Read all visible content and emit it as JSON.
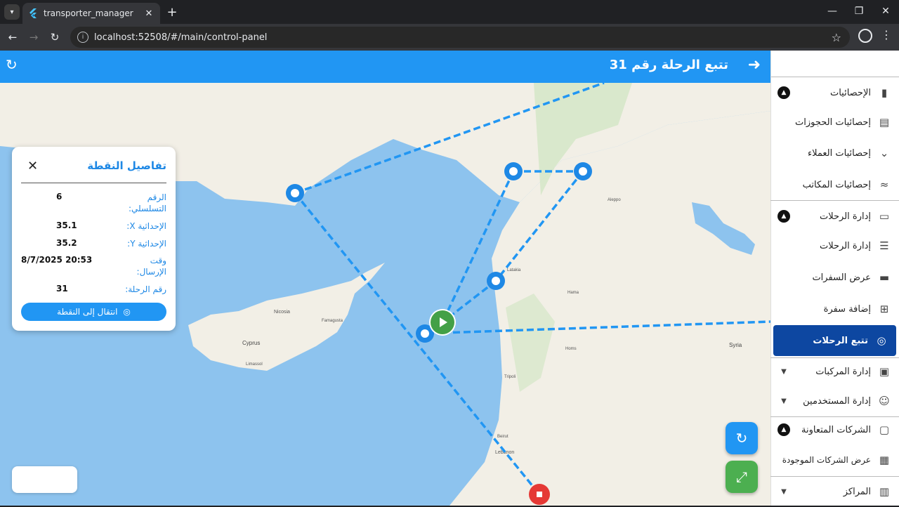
{
  "browser": {
    "tab_title": "transporter_manager",
    "url": "localhost:52508/#/main/control-panel"
  },
  "appbar": {
    "title": "تتبع الرحلة رقم 31"
  },
  "sidebar": {
    "items": [
      {
        "label": "الإحصائيات",
        "icon": "bar-chart-icon",
        "chevron": "open"
      },
      {
        "label": "إحصائيات الحجوزات",
        "icon": "chart-box-icon"
      },
      {
        "label": "إحصائيات العملاء",
        "icon": "trend-icon"
      },
      {
        "label": "إحصائيات المكاتب",
        "icon": "trend-alt-icon"
      },
      {
        "label": "إدارة الرحلات",
        "icon": "bus-icon",
        "chevron": "open"
      },
      {
        "label": "إدارة الرحلات",
        "icon": "list-icon"
      },
      {
        "label": "عرض السفرات",
        "icon": "storage-icon"
      },
      {
        "label": "إضافة سفرة",
        "icon": "add-box-icon"
      },
      {
        "label": "تتبع الرحلات",
        "icon": "gps-icon",
        "active": true
      },
      {
        "label": "إدارة المركبات",
        "icon": "vehicle-alert-icon",
        "chevron": "closed"
      },
      {
        "label": "إدارة المستخدمين",
        "icon": "users-icon",
        "chevron": "closed"
      },
      {
        "label": "الشركات المتعاونة",
        "icon": "briefcase-icon",
        "chevron": "open"
      },
      {
        "label": "عرض الشركات الموجودة",
        "icon": "business-icon"
      },
      {
        "label": "المراكز",
        "icon": "building-icon",
        "chevron": "closed"
      }
    ]
  },
  "detail": {
    "title": "تفاصيل النقطة",
    "rows": [
      {
        "key": "الرقم التسلسلي:",
        "value": "6"
      },
      {
        "key": "الإحداثية X:",
        "value": "35.1"
      },
      {
        "key": "الإحداثية Y:",
        "value": "35.2"
      },
      {
        "key": "وقت الإرسال:",
        "value": "20:53 8/7/2025"
      },
      {
        "key": "رقم الرحلة:",
        "value": "31"
      }
    ],
    "goto_label": "انتقال إلى النقطة"
  },
  "map": {
    "labels": {
      "nicosia": "Nicosia",
      "cyprus": "Cyprus",
      "syria": "Syria",
      "lebanon": "Lebanon",
      "aleppo": "Aleppo",
      "limassol": "Limassol",
      "famagusta": "Famagusta",
      "latakia": "Latakia",
      "tripoli": "Tripoli",
      "beirut": "Beirut",
      "homs": "Homs",
      "hama": "Hama"
    },
    "colors": {
      "sea": "#8dc3ee",
      "land": "#f2efe6",
      "route": "#2196f3",
      "start": "#43a047",
      "stop": "#e53935"
    }
  }
}
